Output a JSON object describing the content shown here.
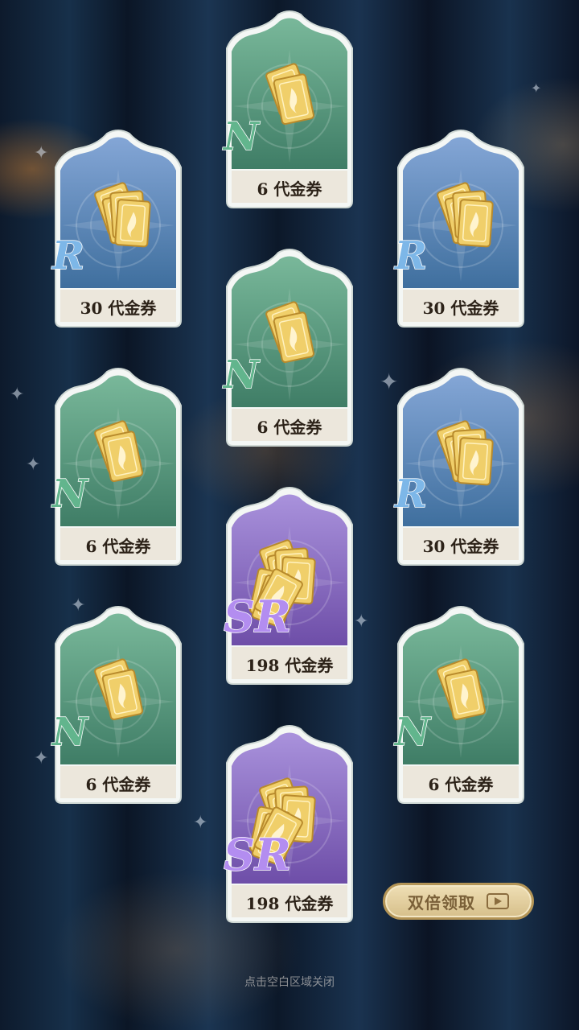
{
  "cards": [
    {
      "rarity": "N",
      "label": "6 代金券"
    },
    {
      "rarity": "R",
      "label": "30 代金券"
    },
    {
      "rarity": "R",
      "label": "30 代金券"
    },
    {
      "rarity": "N",
      "label": "6 代金券"
    },
    {
      "rarity": "N",
      "label": "6 代金券"
    },
    {
      "rarity": "R",
      "label": "30 代金券"
    },
    {
      "rarity": "SR",
      "label": "198 代金券"
    },
    {
      "rarity": "N",
      "label": "6 代金券"
    },
    {
      "rarity": "N",
      "label": "6 代金券"
    },
    {
      "rarity": "SR",
      "label": "198 代金券"
    }
  ],
  "double_claim_label": "双倍领取",
  "close_hint": "点击空白区域关闭",
  "colors": {
    "n_bg": "#5e9c82",
    "r_bg": "#5f86b8",
    "sr_bg": "#8c6cc0",
    "label_bg": "#ece7dc",
    "frame": "#e8eeec"
  }
}
